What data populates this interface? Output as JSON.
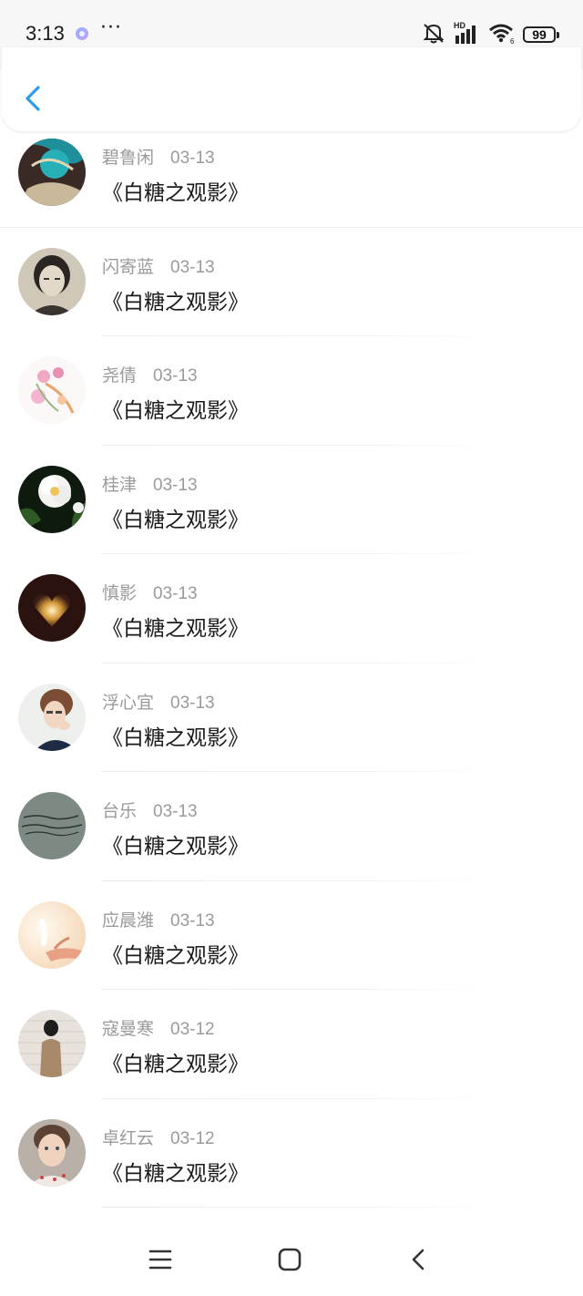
{
  "status_bar": {
    "time": "3:13",
    "dots": "···",
    "network_label": "HD",
    "battery": "99"
  },
  "messages": [
    {
      "name": "碧鲁闲",
      "date": "03-13",
      "title": "《白糖之观影》",
      "avatar": "blue-teal-yarn"
    },
    {
      "name": "闪寄蓝",
      "date": "03-13",
      "title": "《白糖之观影》",
      "avatar": "vintage-portrait"
    },
    {
      "name": "尧倩",
      "date": "03-13",
      "title": "《白糖之观影》",
      "avatar": "pink-floral"
    },
    {
      "name": "桂津",
      "date": "03-13",
      "title": "《白糖之观影》",
      "avatar": "white-peony"
    },
    {
      "name": "慎影",
      "date": "03-13",
      "title": "《白糖之观影》",
      "avatar": "glowing-heart"
    },
    {
      "name": "浮心宜",
      "date": "03-13",
      "title": "《白糖之观影》",
      "avatar": "girl-portrait"
    },
    {
      "name": "台乐",
      "date": "03-13",
      "title": "《白糖之观影》",
      "avatar": "handwriting-wall"
    },
    {
      "name": "应晨潍",
      "date": "03-13",
      "title": "《白糖之观影》",
      "avatar": "hand-light"
    },
    {
      "name": "寇曼寒",
      "date": "03-12",
      "title": "《白糖之观影》",
      "avatar": "girl-brick-wall"
    },
    {
      "name": "卓红云",
      "date": "03-12",
      "title": "《白糖之观影》",
      "avatar": "child-portrait"
    }
  ],
  "colors": {
    "accent": "#2e9be8",
    "name_text": "#9a9a9a",
    "title_text": "#1a1a1a"
  }
}
